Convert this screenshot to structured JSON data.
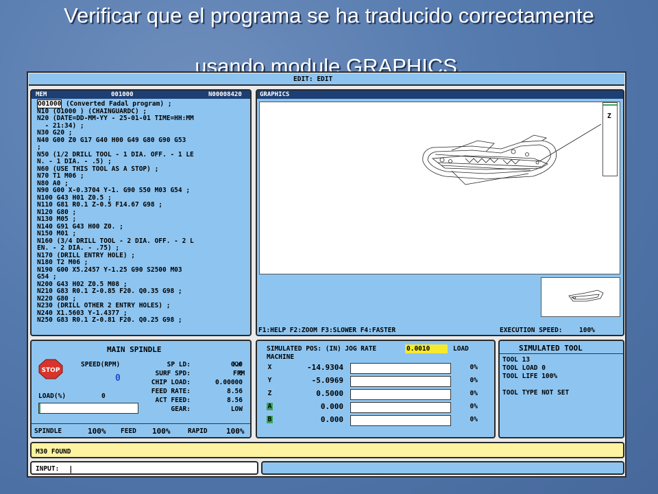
{
  "slide": {
    "title_line1": "Verificar que  el programa se ha traducido correctamente",
    "title_line2": "usando  module  GRAPHICS."
  },
  "header": {
    "mode": "EDIT: EDIT"
  },
  "program_panel": {
    "mem_label": "MEM",
    "program_id": "001000",
    "program_number": "N00008420",
    "lines": [
      {
        "cursor": "O01000",
        "rest": " (Converted Fadal program) ;"
      },
      {
        "text": "N10 (O1000 ) (CHAINGUARDC) ;"
      },
      {
        "text": "N20 (DATE=DD-MM-YY - 25-01-01 TIME=HH:MM"
      },
      {
        "text": "  - 21:34) ;"
      },
      {
        "text": "N30 G20 ;"
      },
      {
        "text": "N40 G00 Z0 G17 G40 H00 G49 G80 G90 G53"
      },
      {
        "text": ";"
      },
      {
        "text": "N50 (1/2 DRILL TOOL - 1 DIA. OFF. - 1 LE"
      },
      {
        "text": "N. - 1 DIA. - .5) ;"
      },
      {
        "text": "N60 (USE THIS TOOL AS A STOP) ;"
      },
      {
        "text": "N70 T1 M06 ;"
      },
      {
        "text": "N80 A0 ;"
      },
      {
        "text": "N90 G00 X-0.3704 Y-1. G90 S50 M03 G54 ;"
      },
      {
        "text": "N100 G43 H01 Z0.5 ;"
      },
      {
        "text": "N110 G81 R0.1 Z-0.5 F14.67 G98 ;"
      },
      {
        "text": "N120 G80 ;"
      },
      {
        "text": "N130 M05 ;"
      },
      {
        "text": "N140 G91 G43 H00 Z0. ;"
      },
      {
        "text": "N150 M01 ;"
      },
      {
        "text": "N160 (3/4 DRILL TOOL - 2 DIA. OFF. - 2 L"
      },
      {
        "text": "EN. - 2 DIA. - .75) ;"
      },
      {
        "text": "N170 (DRILL ENTRY HOLE) ;"
      },
      {
        "text": "N180 T2 M06 ;"
      },
      {
        "text": "N190 G00 X5.2457 Y-1.25 G90 S2500 M03"
      },
      {
        "text": "G54 ;"
      },
      {
        "text": "N200 G43 H02 Z0.5 M08 ;"
      },
      {
        "text": "N210 G83 R0.1 Z-0.85 F20. Q0.35 G98 ;"
      },
      {
        "text": "N220 G80 ;"
      },
      {
        "text": "N230 (DRILL OTHER 2 ENTRY HOLES) ;"
      },
      {
        "text": "N240 X1.5603 Y-1.4377 ;"
      },
      {
        "text": "N250 G83 R0.1 Z-0.81 F20. Q0.25 G98 ;"
      }
    ]
  },
  "graphics_panel": {
    "title": "GRAPHICS",
    "z_label": "Z",
    "fkeys": "F1:HELP F2:ZOOM F3:SLOWER F4:FASTER",
    "exec_speed_label": "EXECUTION SPEED:",
    "exec_speed_value": "100%"
  },
  "spindle_panel": {
    "title": "MAIN SPINDLE",
    "stop_label": "STOP",
    "speed_label": "SPEED(RPM)",
    "speed_value": "0",
    "load_label": "LOAD(%)",
    "load_value": "0",
    "params": [
      {
        "label": "SP LD:",
        "value": "0.0",
        "unit": "KW"
      },
      {
        "label": "SURF SPD:",
        "value": "0",
        "unit": "FPM"
      },
      {
        "label": "CHIP LOAD:",
        "value": "0.00000",
        "unit": ""
      },
      {
        "label": "FEED RATE:",
        "value": "8.56",
        "unit": ""
      },
      {
        "label": "ACT FEED:",
        "value": "8.56",
        "unit": ""
      },
      {
        "label": "GEAR:",
        "value": "LOW",
        "unit": ""
      }
    ],
    "footer": {
      "spindle_label": "SPINDLE",
      "spindle_value": "100%",
      "feed_label": "FEED",
      "feed_value": "100%",
      "rapid_label": "RAPID",
      "rapid_value": "100%"
    }
  },
  "position_panel": {
    "title": "SIMULATED POS: (IN) JOG RATE",
    "jog_rate": "0.0010",
    "load_label": "LOAD",
    "machine_label": "MACHINE",
    "axes": [
      {
        "axis": "X",
        "value": "-14.9304",
        "load": "0%",
        "highlight": false
      },
      {
        "axis": "Y",
        "value": "-5.0969",
        "load": "0%",
        "highlight": false
      },
      {
        "axis": "Z",
        "value": "0.5000",
        "load": "0%",
        "highlight": false
      },
      {
        "axis": "A",
        "value": "0.000",
        "load": "0%",
        "highlight": true
      },
      {
        "axis": "B",
        "value": "0.000",
        "load": "0%",
        "highlight": true
      }
    ]
  },
  "tool_panel": {
    "title": "SIMULATED TOOL",
    "lines": [
      "TOOL 13",
      "TOOL LOAD 0",
      "TOOL LIFE 100%",
      "",
      "TOOL TYPE NOT SET"
    ]
  },
  "message": {
    "text": "M30 FOUND"
  },
  "input": {
    "label": "INPUT:",
    "cursor": "|"
  },
  "colors": {
    "panel": "#8ec5f0",
    "dark_bar": "#1d3f73",
    "yellow": "#fdf3a0",
    "stop": "#d9342b"
  }
}
